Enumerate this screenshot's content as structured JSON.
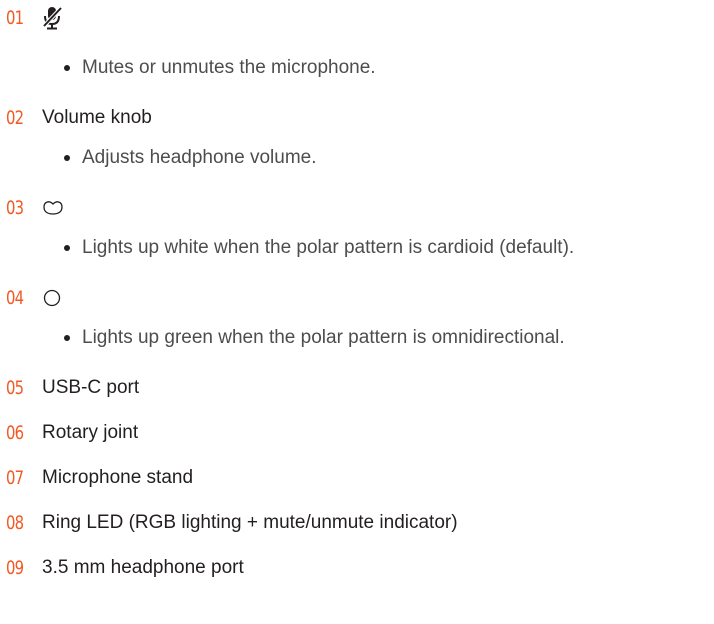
{
  "items": [
    {
      "number": "01",
      "icon": "mic-mute-icon",
      "label": "",
      "description": "Mutes or unmutes the microphone."
    },
    {
      "number": "02",
      "label": "Volume knob",
      "description": "Adjusts headphone volume."
    },
    {
      "number": "03",
      "icon": "cardioid-pattern-icon",
      "label": "",
      "description": "Lights up white when the polar pattern is cardioid (default)."
    },
    {
      "number": "04",
      "icon": "omnidirectional-pattern-icon",
      "label": "",
      "description": "Lights up green when the polar pattern is omnidirectional."
    },
    {
      "number": "05",
      "label": "USB-C port"
    },
    {
      "number": "06",
      "label": "Rotary joint"
    },
    {
      "number": "07",
      "label": "Microphone stand"
    },
    {
      "number": "08",
      "label": "Ring LED (RGB lighting + mute/unmute indicator)"
    },
    {
      "number": "09",
      "label": "3.5 mm headphone port"
    }
  ],
  "colors": {
    "number": "#f15a24",
    "label": "#231f20",
    "description": "#4d4d4f"
  }
}
